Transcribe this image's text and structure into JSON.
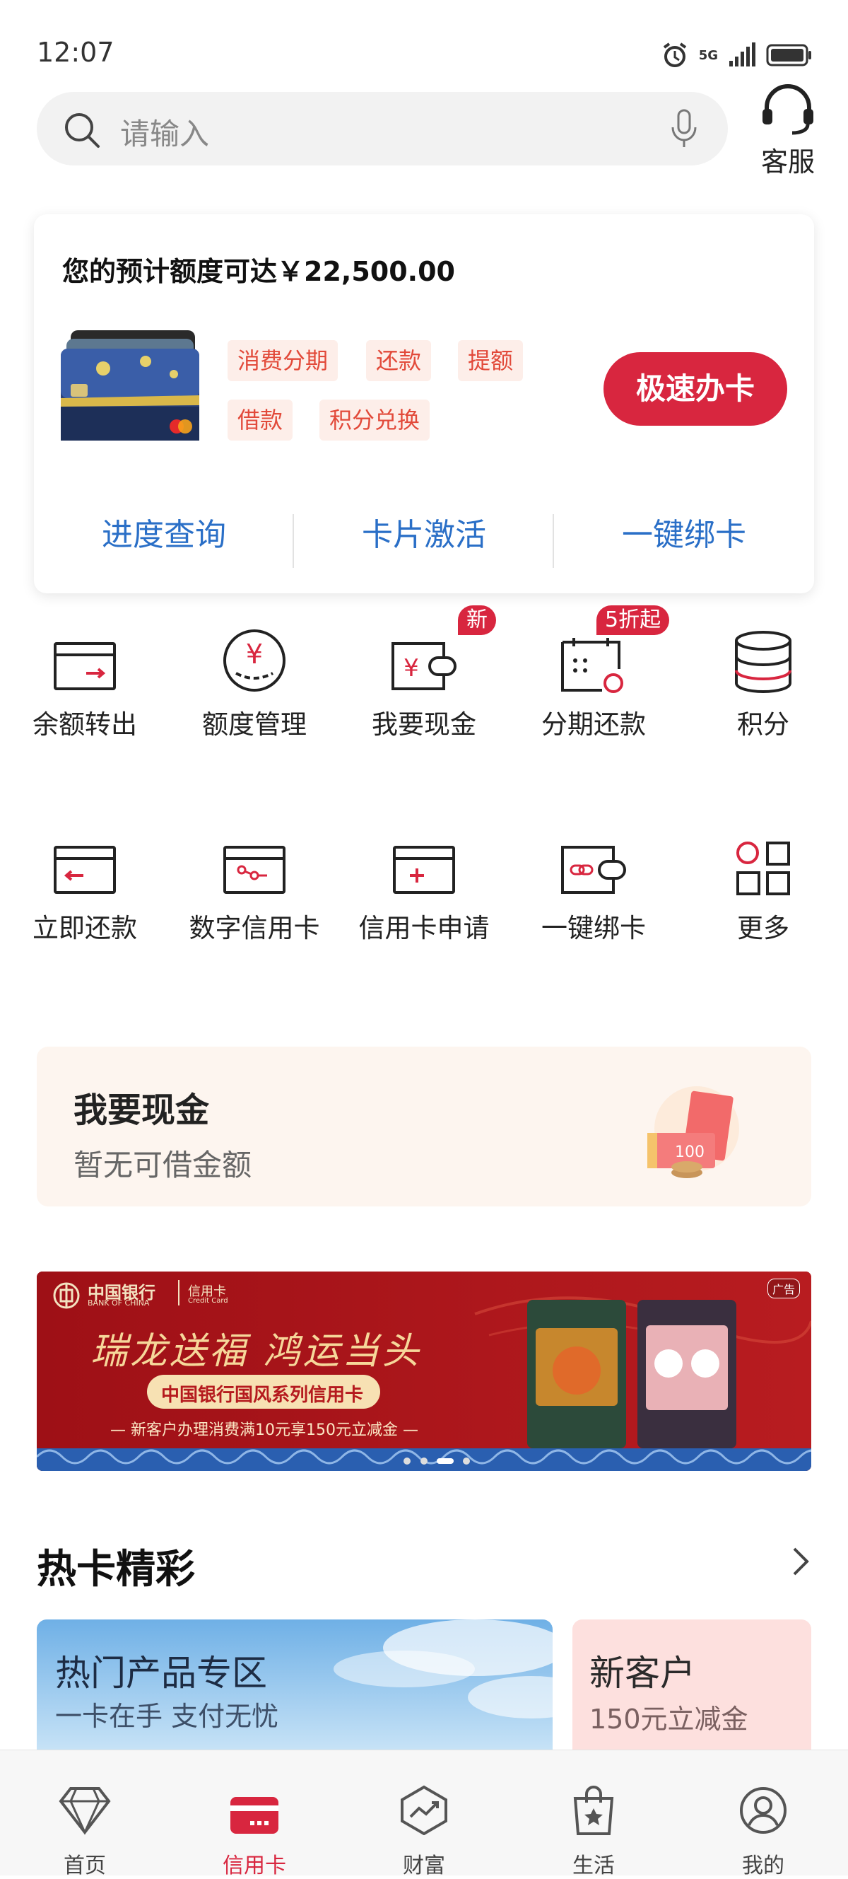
{
  "status_bar": {
    "time": "12:07",
    "network": "5G"
  },
  "search": {
    "placeholder": "请输入"
  },
  "service": {
    "label": "客服"
  },
  "credit_card": {
    "limit_text": "您的预计额度可达￥22,500.00",
    "tags": [
      "消费分期",
      "还款",
      "提额",
      "借款",
      "积分兑换"
    ],
    "apply_button": "极速办卡",
    "links": [
      "进度查询",
      "卡片激活",
      "一键绑卡"
    ]
  },
  "grid_row1": [
    {
      "label": "余额转出",
      "icon": "card-transfer-icon",
      "badge": ""
    },
    {
      "label": "额度管理",
      "icon": "yuan-circle-icon",
      "badge": ""
    },
    {
      "label": "我要现金",
      "icon": "wallet-yuan-icon",
      "badge": "新"
    },
    {
      "label": "分期还款",
      "icon": "calendar-icon",
      "badge": "5折起"
    },
    {
      "label": "积分",
      "icon": "database-icon",
      "badge": ""
    }
  ],
  "grid_row2": [
    {
      "label": "立即还款",
      "icon": "card-repay-icon"
    },
    {
      "label": "数字信用卡",
      "icon": "digital-card-icon"
    },
    {
      "label": "信用卡申请",
      "icon": "card-add-icon"
    },
    {
      "label": "一键绑卡",
      "icon": "wallet-link-icon"
    },
    {
      "label": "更多",
      "icon": "grid-more-icon"
    }
  ],
  "cash_promo": {
    "title": "我要现金",
    "subtitle": "暂无可借金额",
    "bill_text": "100"
  },
  "banner": {
    "bank_name": "中国银行",
    "bank_name_en": "BANK OF CHINA",
    "card_type": "信用卡",
    "card_type_en": "Credit Card",
    "ad_label": "广告",
    "headline": "瑞龙送福 鸿运当头",
    "subheadline": "中国银行国风系列信用卡",
    "offer": "— 新客户办理消费满10元享150元立减金 —"
  },
  "hot_section": {
    "title": "热卡精彩"
  },
  "promo_cards": [
    {
      "title": "热门产品专区",
      "subtitle": "一卡在手 支付无忧"
    },
    {
      "title": "新客户",
      "subtitle": "150元立减金"
    }
  ],
  "tabbar": [
    {
      "label": "首页",
      "icon": "diamond-icon"
    },
    {
      "label": "信用卡",
      "icon": "credit-card-icon"
    },
    {
      "label": "财富",
      "icon": "wealth-chart-icon"
    },
    {
      "label": "生活",
      "icon": "shopping-bag-icon"
    },
    {
      "label": "我的",
      "icon": "user-icon"
    }
  ],
  "colors": {
    "accent": "#d8263f",
    "link": "#2a6fc7",
    "tag_bg": "#fdeee9",
    "tag_text": "#e24a3a"
  }
}
